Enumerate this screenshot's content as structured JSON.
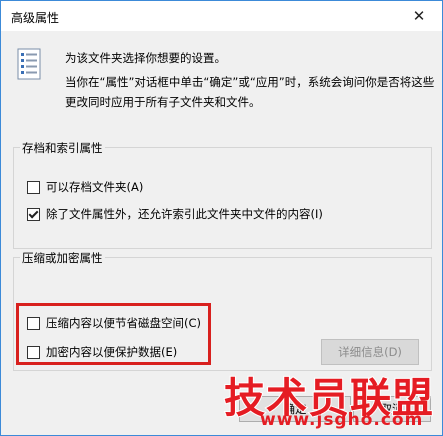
{
  "window": {
    "title": "高级属性",
    "close_glyph": "✕"
  },
  "description": {
    "line1": "为该文件夹选择你想要的设置。",
    "line2": "当你在“属性”对话框中单击“确定”或“应用”时，系统会询问你是否将这些更改同时应用于所有子文件夹和文件。",
    "icon": "settings-list-icon"
  },
  "archive_group": {
    "title": "存档和索引属性",
    "options": [
      {
        "label": "可以存档文件夹(A)",
        "checked": false
      },
      {
        "label": "除了文件属性外，还允许索引此文件夹中文件的内容(I)",
        "checked": true
      }
    ]
  },
  "compress_group": {
    "title": "压缩或加密属性",
    "options": [
      {
        "label": "压缩内容以便节省磁盘空间(C)",
        "checked": false
      },
      {
        "label": "加密内容以便保护数据(E)",
        "checked": false
      }
    ],
    "details_button": "详细信息(D)"
  },
  "footer": {
    "ok": "确定",
    "cancel": "取消"
  },
  "watermark": {
    "text": "技术员联盟",
    "url": "www.jsgho.com"
  },
  "colors": {
    "highlight": "#d8201e",
    "watermark": "#e51c23",
    "border": "#3c8ad8"
  }
}
